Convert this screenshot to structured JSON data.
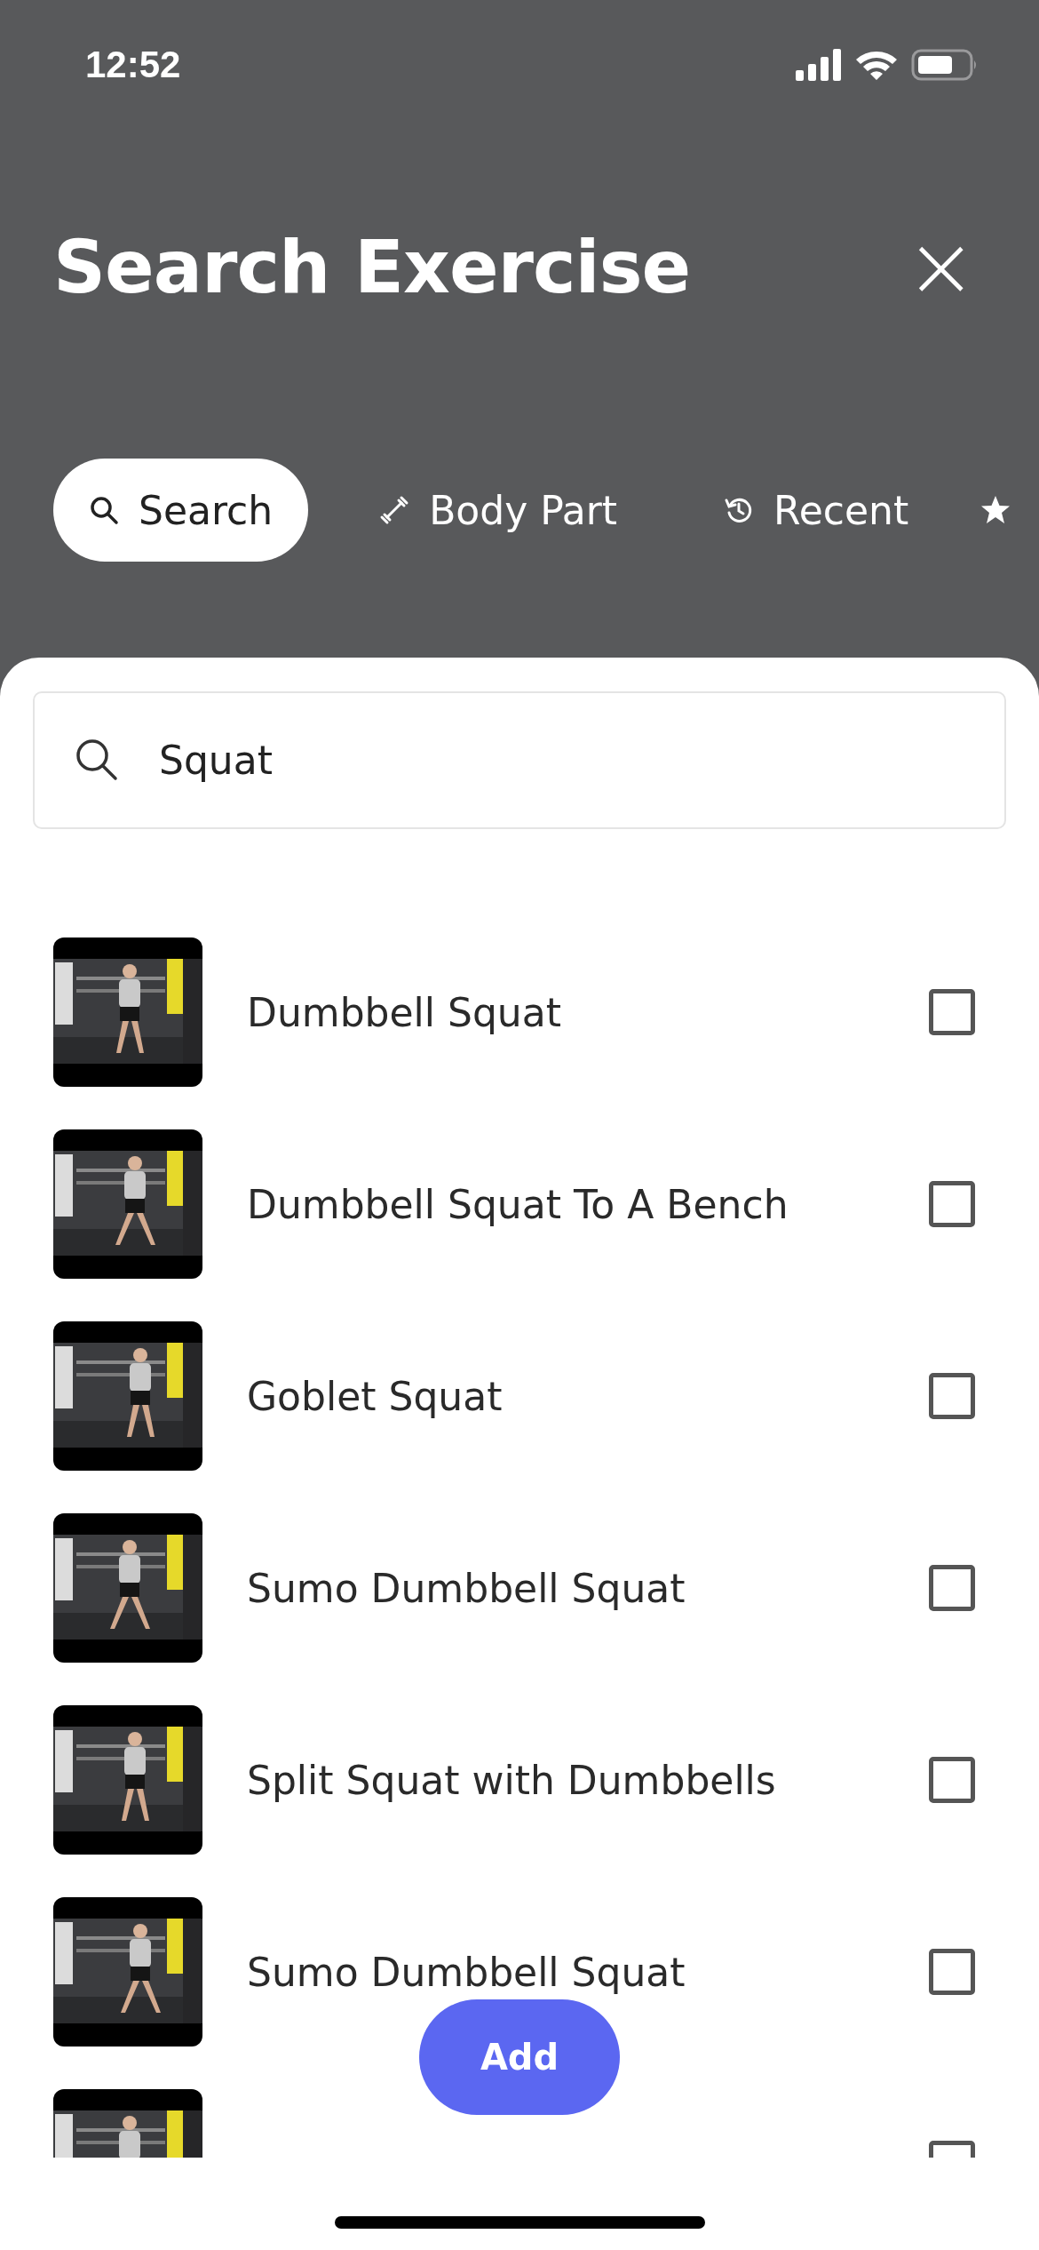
{
  "status_bar": {
    "time": "12:52"
  },
  "header": {
    "title": "Search Exercise",
    "close": "×"
  },
  "tabs": [
    {
      "label": "Search",
      "selected": true
    },
    {
      "label": "Body Part",
      "selected": false
    },
    {
      "label": "Recent",
      "selected": false
    }
  ],
  "search": {
    "value": "Squat"
  },
  "exercises": [
    {
      "name": "Dumbbell Squat",
      "checked": false
    },
    {
      "name": "Dumbbell Squat To A Bench",
      "checked": false
    },
    {
      "name": "Goblet Squat",
      "checked": false
    },
    {
      "name": "Sumo Dumbbell Squat",
      "checked": false
    },
    {
      "name": "Split Squat with Dumbbells",
      "checked": false
    },
    {
      "name": "Sumo Dumbbell Squat",
      "checked": false
    },
    {
      "checked": false
    }
  ],
  "add_button": {
    "label": "Add"
  }
}
